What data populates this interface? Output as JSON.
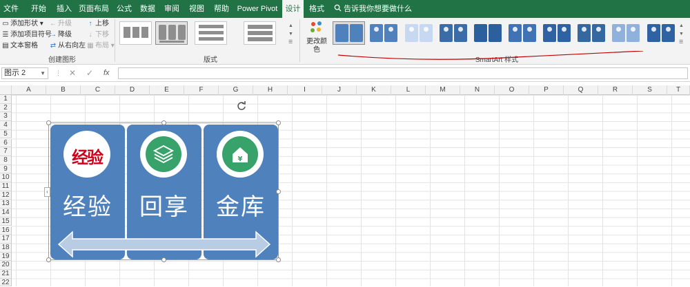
{
  "tabs": [
    "文件",
    "开始",
    "插入",
    "页面布局",
    "公式",
    "数据",
    "审阅",
    "视图",
    "帮助",
    "Power Pivot",
    "设计",
    "格式"
  ],
  "tell_me": "告诉我你想要做什么",
  "create_graphic": {
    "commands": [
      "添加形状",
      "添加项目符号",
      "文本窗格",
      "升级",
      "降级",
      "从右向左",
      "上移",
      "下移",
      "布局"
    ],
    "group_label": "创建图形"
  },
  "layouts": {
    "group_label": "版式"
  },
  "styles": {
    "change_colors": "更改颜色",
    "group_label": "SmartArt 样式"
  },
  "formula_bar": {
    "name_box": "图示 2",
    "cancel": "✕",
    "enter": "✓",
    "fx": "fx",
    "formula": ""
  },
  "columns": [
    "A",
    "B",
    "C",
    "D",
    "E",
    "F",
    "G",
    "H",
    "I",
    "J",
    "K",
    "L",
    "M",
    "N",
    "O",
    "P",
    "Q",
    "R",
    "S",
    "T"
  ],
  "rows": [
    "1",
    "2",
    "3",
    "4",
    "5",
    "6",
    "7",
    "8",
    "9",
    "10",
    "11",
    "12",
    "13",
    "14",
    "15",
    "16",
    "17",
    "18",
    "19",
    "20",
    "21",
    "22"
  ],
  "smartart": {
    "panels": [
      {
        "label": "经验",
        "icon": "经验"
      },
      {
        "label": "回享",
        "icon": "layers-icon"
      },
      {
        "label": "金库",
        "icon": "house-yen-icon"
      }
    ],
    "panel_color": "#4f81bd",
    "icon_color": "#37a36b",
    "arrow_color": "#b8cce4",
    "logo_color": "#d0021b"
  }
}
